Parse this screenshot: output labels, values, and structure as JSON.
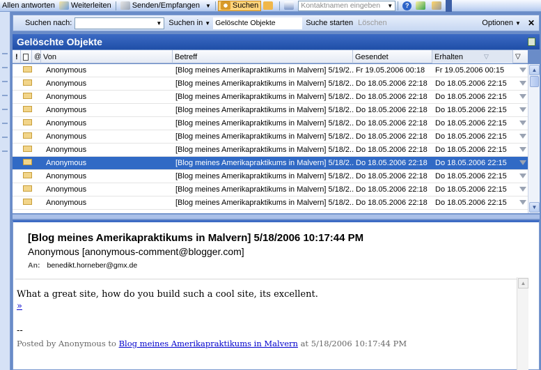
{
  "toolbar": {
    "reply_all": "Allen antworten",
    "forward": "Weiterleiten",
    "send_receive": "Senden/Empfangen",
    "find": "Suchen",
    "contact_placeholder": "Kontaktnamen eingeben"
  },
  "search": {
    "search_for_label": "Suchen nach:",
    "search_for_value": "",
    "search_in_label": "Suchen in",
    "search_in_value": "Gelöschte Objekte",
    "start": "Suche starten",
    "clear": "Löschen",
    "options": "Optionen"
  },
  "folder": {
    "title": "Gelöschte Objekte"
  },
  "columns": {
    "importance": "!",
    "from": "Von",
    "subject": "Betreff",
    "sent": "Gesendet",
    "received": "Erhalten"
  },
  "messages": [
    {
      "from": "Anonymous",
      "subject": "[Blog meines Amerikapraktikums in Malvern] 5/19/2...",
      "sent": "Fr 19.05.2006 00:18",
      "received": "Fr 19.05.2006 00:15"
    },
    {
      "from": "Anonymous",
      "subject": "[Blog meines Amerikapraktikums in Malvern] 5/18/2...",
      "sent": "Do 18.05.2006 22:18",
      "received": "Do 18.05.2006 22:15"
    },
    {
      "from": "Anonymous",
      "subject": "[Blog meines Amerikapraktikums in Malvern] 5/18/2...",
      "sent": "Do 18.05.2006 22:18",
      "received": "Do 18.05.2006 22:15"
    },
    {
      "from": "Anonymous",
      "subject": "[Blog meines Amerikapraktikums in Malvern] 5/18/2...",
      "sent": "Do 18.05.2006 22:18",
      "received": "Do 18.05.2006 22:15"
    },
    {
      "from": "Anonymous",
      "subject": "[Blog meines Amerikapraktikums in Malvern] 5/18/2...",
      "sent": "Do 18.05.2006 22:18",
      "received": "Do 18.05.2006 22:15"
    },
    {
      "from": "Anonymous",
      "subject": "[Blog meines Amerikapraktikums in Malvern] 5/18/2...",
      "sent": "Do 18.05.2006 22:18",
      "received": "Do 18.05.2006 22:15"
    },
    {
      "from": "Anonymous",
      "subject": "[Blog meines Amerikapraktikums in Malvern] 5/18/2...",
      "sent": "Do 18.05.2006 22:18",
      "received": "Do 18.05.2006 22:15"
    },
    {
      "from": "Anonymous",
      "subject": "[Blog meines Amerikapraktikums in Malvern] 5/18/2...",
      "sent": "Do 18.05.2006 22:18",
      "received": "Do 18.05.2006 22:15",
      "selected": true
    },
    {
      "from": "Anonymous",
      "subject": "[Blog meines Amerikapraktikums in Malvern] 5/18/2...",
      "sent": "Do 18.05.2006 22:18",
      "received": "Do 18.05.2006 22:15"
    },
    {
      "from": "Anonymous",
      "subject": "[Blog meines Amerikapraktikums in Malvern] 5/18/2...",
      "sent": "Do 18.05.2006 22:18",
      "received": "Do 18.05.2006 22:15"
    },
    {
      "from": "Anonymous",
      "subject": "[Blog meines Amerikapraktikums in Malvern] 5/18/2...",
      "sent": "Do 18.05.2006 22:18",
      "received": "Do 18.05.2006 22:15"
    }
  ],
  "message": {
    "subject": "[Blog meines Amerikapraktikums in Malvern] 5/18/2006 10:17:44 PM",
    "from": "Anonymous [anonymous-comment@blogger.com]",
    "to_label": "An:",
    "to": "benedikt.horneber@gmx.de",
    "body": "What a great site, how do you build such a cool site, its excellent.",
    "link": "»",
    "signature_sep": "--",
    "posted_by_prefix": "Posted by Anonymous to",
    "posted_link": "Blog meines Amerikapraktikums in Malvern",
    "posted_suffix": "at 5/18/2006 10:17:44 PM"
  },
  "colors": {
    "selection": "#316ac5",
    "header": "#1f4fa8",
    "toolbar": "#c9d9f4"
  }
}
